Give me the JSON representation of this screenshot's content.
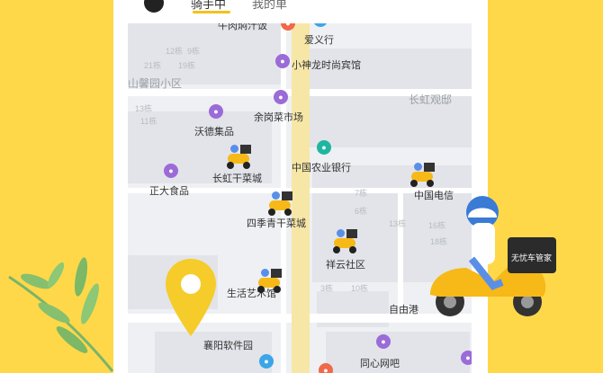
{
  "header": {
    "tab_active": "骑手中",
    "tab_other": "我的单"
  },
  "map": {
    "places": {
      "niurou": "牛肉焖汁饭",
      "aiyixing": "爱义行",
      "xiaoshenlong": "小神龙时尚宾馆",
      "shanxinyuan": "山馨园小区",
      "changhong_guandi": "长虹观邸",
      "yugang": "余岗菜市场",
      "wode": "沃德集品",
      "nongye": "中国农业银行",
      "changhong_gancai": "长虹干菜城",
      "zhengda": "正大食品",
      "dianxin": "中国电信",
      "siji": "四季青干菜城",
      "xiangyun": "祥云社区",
      "shenghuo": "生活艺术馆",
      "ziyou": "自由港",
      "xiangyang": "襄阳软件园",
      "tongxin": "同心网吧"
    },
    "building_labels": [
      "12栋",
      "9栋",
      "21栋",
      "19栋",
      "13栋",
      "11栋",
      "7栋",
      "6栋",
      "13栋",
      "16栋",
      "18栋",
      "3栋",
      "10栋"
    ]
  },
  "banner": {
    "box_text": "无忧车管家"
  },
  "colors": {
    "background": "#ffd84a",
    "accent": "#f2c21b",
    "road": "#f7e7a6"
  },
  "icons": [
    "menu-icon",
    "location-pin-icon",
    "delivery-rider-icon",
    "leaf-decoration-icon"
  ]
}
